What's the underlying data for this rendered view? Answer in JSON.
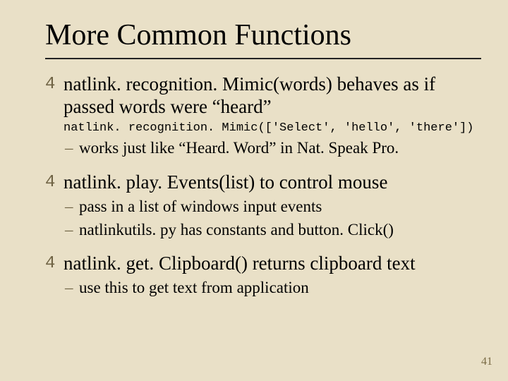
{
  "title": "More Common Functions",
  "items": [
    {
      "text": "natlink. recognition. Mimic(words) behaves as if passed words were “heard”",
      "code": "natlink. recognition. Mimic(['Select', 'hello', 'there'])",
      "sub": [
        "works just like “Heard. Word” in Nat. Speak Pro."
      ]
    },
    {
      "text": "natlink. play. Events(list) to control mouse",
      "sub": [
        "pass in a list of windows input events",
        "natlinkutils. py has constants and button. Click()"
      ]
    },
    {
      "text": "natlink. get. Clipboard() returns clipboard text",
      "sub": [
        "use this to get text from application"
      ]
    }
  ],
  "bullet_glyph": "4",
  "dash_glyph": "–",
  "page_number": "41"
}
